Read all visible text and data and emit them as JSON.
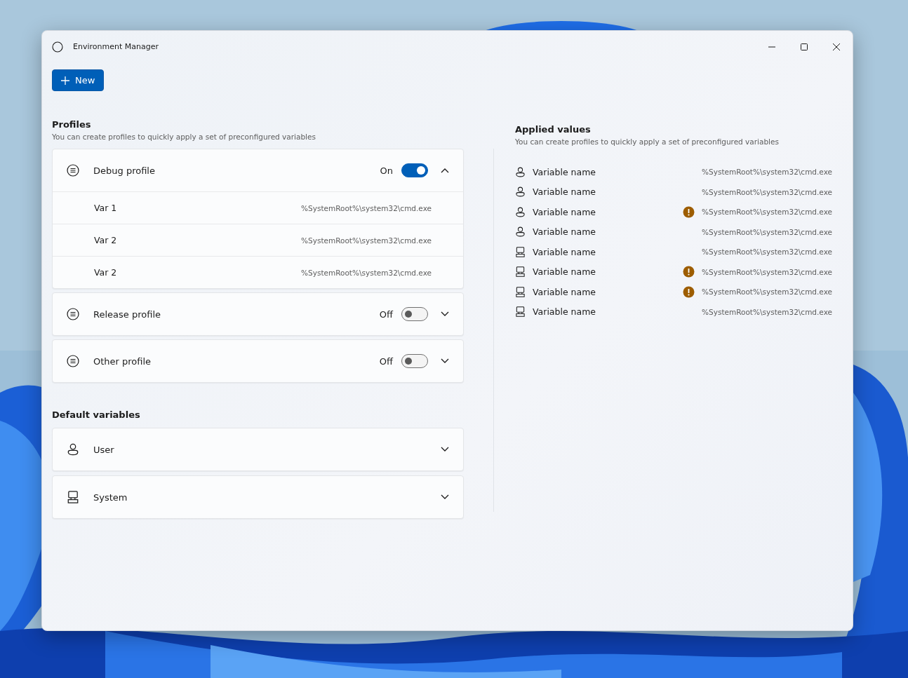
{
  "window": {
    "title": "Environment Manager"
  },
  "new_button": {
    "label": "New"
  },
  "profiles": {
    "title": "Profiles",
    "subtitle": "You can create profiles to quickly apply a set of preconfigured variables",
    "items": [
      {
        "name": "Debug profile",
        "state_label": "On",
        "on": true,
        "expanded": true,
        "variables": [
          {
            "name": "Var 1",
            "value": "%SystemRoot%\\system32\\cmd.exe"
          },
          {
            "name": "Var 2",
            "value": "%SystemRoot%\\system32\\cmd.exe"
          },
          {
            "name": "Var 2",
            "value": "%SystemRoot%\\system32\\cmd.exe"
          }
        ]
      },
      {
        "name": "Release profile",
        "state_label": "Off",
        "on": false,
        "expanded": false
      },
      {
        "name": "Other profile",
        "state_label": "Off",
        "on": false,
        "expanded": false
      }
    ]
  },
  "default_variables": {
    "title": "Default variables",
    "items": [
      {
        "kind": "user",
        "label": "User",
        "expanded": false
      },
      {
        "kind": "system",
        "label": "System",
        "expanded": false
      }
    ]
  },
  "applied_values": {
    "title": "Applied values",
    "subtitle": "You can create profiles to quickly apply a set of preconfigured variables",
    "rows": [
      {
        "kind": "user",
        "name": "Variable name",
        "value": "%SystemRoot%\\system32\\cmd.exe",
        "warning": false
      },
      {
        "kind": "user",
        "name": "Variable name",
        "value": "%SystemRoot%\\system32\\cmd.exe",
        "warning": false
      },
      {
        "kind": "user",
        "name": "Variable name",
        "value": "%SystemRoot%\\system32\\cmd.exe",
        "warning": true
      },
      {
        "kind": "user",
        "name": "Variable name",
        "value": "%SystemRoot%\\system32\\cmd.exe",
        "warning": false
      },
      {
        "kind": "system",
        "name": "Variable name",
        "value": "%SystemRoot%\\system32\\cmd.exe",
        "warning": false
      },
      {
        "kind": "system",
        "name": "Variable name",
        "value": "%SystemRoot%\\system32\\cmd.exe",
        "warning": true
      },
      {
        "kind": "system",
        "name": "Variable name",
        "value": "%SystemRoot%\\system32\\cmd.exe",
        "warning": true
      },
      {
        "kind": "system",
        "name": "Variable name",
        "value": "%SystemRoot%\\system32\\cmd.exe",
        "warning": false
      }
    ]
  }
}
